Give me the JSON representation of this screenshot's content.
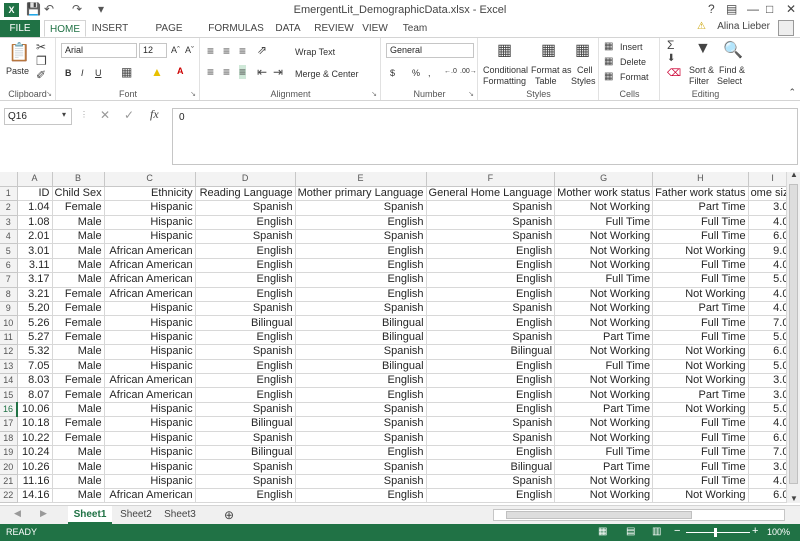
{
  "title": {
    "app_icon": "X",
    "window_title": "EmergentLit_DemographicData.xlsx - Excel",
    "help": "?",
    "undo_icon": "undo-icon",
    "redo_icon": "redo-icon"
  },
  "tabs": [
    "FILE",
    "HOME",
    "INSERT",
    "PAGE LAYOUT",
    "FORMULAS",
    "DATA",
    "REVIEW",
    "VIEW",
    "Team"
  ],
  "user": "Alina Lieber",
  "ribbon": {
    "clipboard": {
      "label": "Clipboard",
      "paste": "Paste"
    },
    "font": {
      "label": "Font",
      "name": "Arial",
      "size": "12",
      "bold": "B",
      "italic": "I",
      "underline": "U"
    },
    "alignment": {
      "label": "Alignment",
      "wrap": "Wrap Text",
      "merge": "Merge & Center"
    },
    "number": {
      "label": "Number",
      "format": "General",
      "currency": "$",
      "percent": "%",
      "comma": ","
    },
    "styles": {
      "label": "Styles",
      "cond1": "Conditional",
      "cond2": "Formatting",
      "table1": "Format as",
      "table2": "Table",
      "cell1": "Cell",
      "cell2": "Styles"
    },
    "cells": {
      "label": "Cells",
      "insert": "Insert",
      "delete": "Delete",
      "format": "Format"
    },
    "editing": {
      "label": "Editing",
      "sort1": "Sort &",
      "sort2": "Filter",
      "find1": "Find &",
      "find2": "Select"
    }
  },
  "formula_bar": {
    "name_box": "Q16",
    "fx": "fx",
    "value": "0"
  },
  "columns": [
    "",
    "A",
    "B",
    "C",
    "D",
    "E",
    "F",
    "G",
    "H",
    "I"
  ],
  "header_row": [
    "ID",
    "Child Sex",
    "Ethnicity",
    "Reading Language",
    "Mother primary Language",
    "General Home Language",
    "Mother work status",
    "Father work status",
    "ome size"
  ],
  "rows": [
    [
      "2",
      "1.04",
      "Female",
      "Hispanic",
      "Spanish",
      "Spanish",
      "Spanish",
      "Not Working",
      "Part Time",
      "3.00"
    ],
    [
      "3",
      "1.08",
      "Male",
      "Hispanic",
      "English",
      "English",
      "Spanish",
      "Full Time",
      "Full Time",
      "4.00"
    ],
    [
      "4",
      "2.01",
      "Male",
      "Hispanic",
      "Spanish",
      "Spanish",
      "Spanish",
      "Not Working",
      "Full Time",
      "6.00"
    ],
    [
      "5",
      "3.01",
      "Male",
      "African American",
      "English",
      "English",
      "English",
      "Not Working",
      "Not Working",
      "9.00"
    ],
    [
      "6",
      "3.11",
      "Male",
      "African American",
      "English",
      "English",
      "English",
      "Not Working",
      "Full Time",
      "4.00"
    ],
    [
      "7",
      "3.17",
      "Male",
      "African American",
      "English",
      "English",
      "English",
      "Full Time",
      "Full Time",
      "5.00"
    ],
    [
      "8",
      "3.21",
      "Female",
      "African American",
      "English",
      "English",
      "English",
      "Not Working",
      "Not Working",
      "4.00"
    ],
    [
      "9",
      "5.20",
      "Female",
      "Hispanic",
      "Spanish",
      "Spanish",
      "Spanish",
      "Not Working",
      "Part Time",
      "4.00"
    ],
    [
      "10",
      "5.26",
      "Female",
      "Hispanic",
      "Bilingual",
      "Bilingual",
      "English",
      "Not Working",
      "Full Time",
      "7.00"
    ],
    [
      "11",
      "5.27",
      "Female",
      "Hispanic",
      "English",
      "Bilingual",
      "Spanish",
      "Part Time",
      "Full Time",
      "5.00"
    ],
    [
      "12",
      "5.32",
      "Male",
      "Hispanic",
      "Spanish",
      "Spanish",
      "Bilingual",
      "Not Working",
      "Not Working",
      "6.00"
    ],
    [
      "13",
      "7.05",
      "Male",
      "Hispanic",
      "English",
      "Bilingual",
      "English",
      "Full Time",
      "Not Working",
      "5.00"
    ],
    [
      "14",
      "8.03",
      "Female",
      "African American",
      "English",
      "English",
      "English",
      "Not Working",
      "Not Working",
      "3.00"
    ],
    [
      "15",
      "8.07",
      "Female",
      "African American",
      "English",
      "English",
      "English",
      "Not Working",
      "Part Time",
      "3.00"
    ],
    [
      "16",
      "10.06",
      "Male",
      "Hispanic",
      "Spanish",
      "Spanish",
      "English",
      "Part Time",
      "Not Working",
      "5.00"
    ],
    [
      "17",
      "10.18",
      "Female",
      "Hispanic",
      "Bilingual",
      "Spanish",
      "Spanish",
      "Not Working",
      "Full Time",
      "4.00"
    ],
    [
      "18",
      "10.22",
      "Female",
      "Hispanic",
      "Spanish",
      "Spanish",
      "Spanish",
      "Not Working",
      "Full Time",
      "6.00"
    ],
    [
      "19",
      "10.24",
      "Male",
      "Hispanic",
      "Bilingual",
      "English",
      "English",
      "Full Time",
      "Full Time",
      "7.00"
    ],
    [
      "20",
      "10.26",
      "Male",
      "Hispanic",
      "Spanish",
      "Spanish",
      "Bilingual",
      "Part Time",
      "Full Time",
      "3.00"
    ],
    [
      "21",
      "11.16",
      "Male",
      "Hispanic",
      "Spanish",
      "Spanish",
      "Spanish",
      "Not Working",
      "Full Time",
      "4.00"
    ],
    [
      "22",
      "14.16",
      "Male",
      "African American",
      "English",
      "English",
      "English",
      "Not Working",
      "Not Working",
      "6.00"
    ]
  ],
  "selected_row": "16",
  "sheets": [
    "Sheet1",
    "Sheet2",
    "Sheet3"
  ],
  "status": {
    "ready": "READY",
    "zoom": "100%",
    "zoom_minus": "−",
    "zoom_plus": "+"
  },
  "colors": {
    "accent": "#207245"
  }
}
